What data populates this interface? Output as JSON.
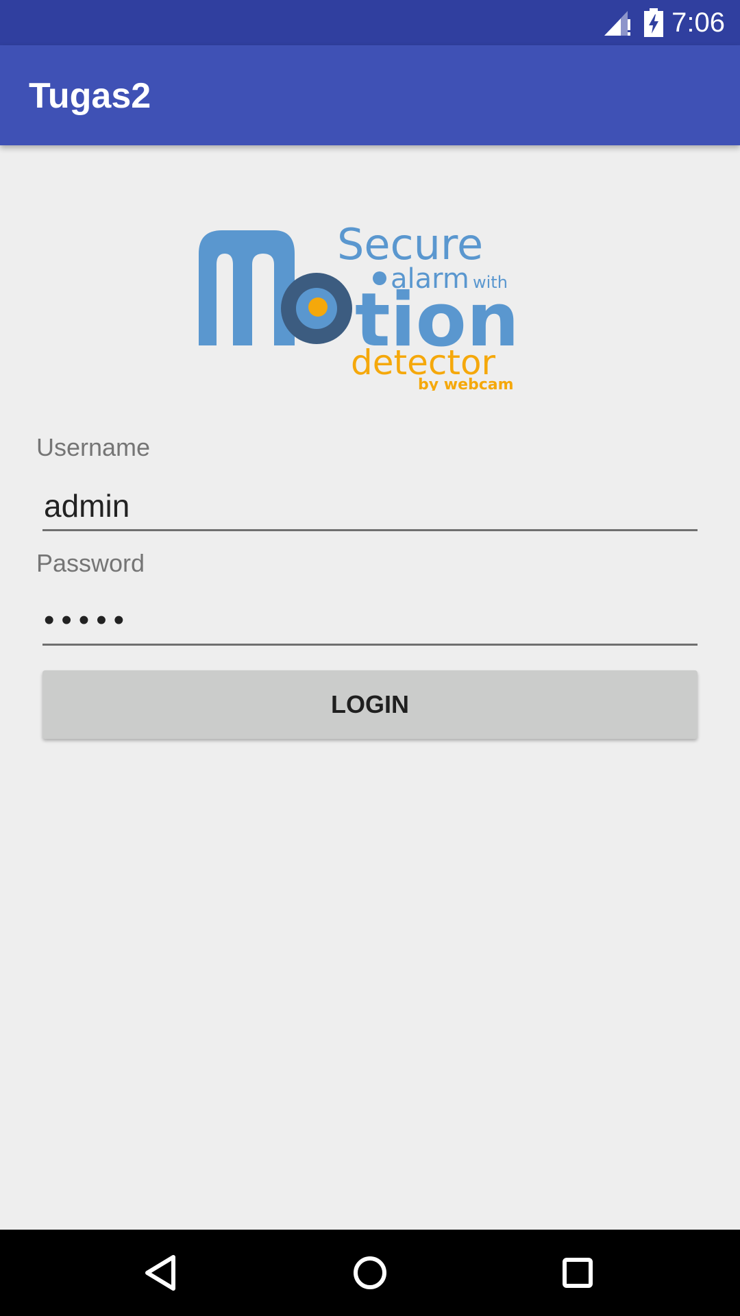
{
  "status_bar": {
    "time": "7:06",
    "signal_icon": "cell-signal-no-data-icon",
    "battery_icon": "battery-charging-icon"
  },
  "app_bar": {
    "title": "Tugas2",
    "color": "#3f51b5",
    "status_color": "#303f9f"
  },
  "logo": {
    "word_secure": "Secure",
    "word_alarm": "alarm",
    "word_with": "with",
    "word_motion_tail": "tion",
    "word_detector": "detector",
    "word_byline": "by webcam",
    "colors": {
      "blue": "#5a97cf",
      "dark": "#3c5c80",
      "orange": "#f5a80b"
    }
  },
  "form": {
    "username_label": "Username",
    "username_value": "admin",
    "password_label": "Password",
    "password_value": "•••••",
    "login_label": "LOGIN"
  },
  "nav_bar": {
    "back_icon": "back-triangle-icon",
    "home_icon": "home-circle-icon",
    "recents_icon": "recents-square-icon"
  }
}
